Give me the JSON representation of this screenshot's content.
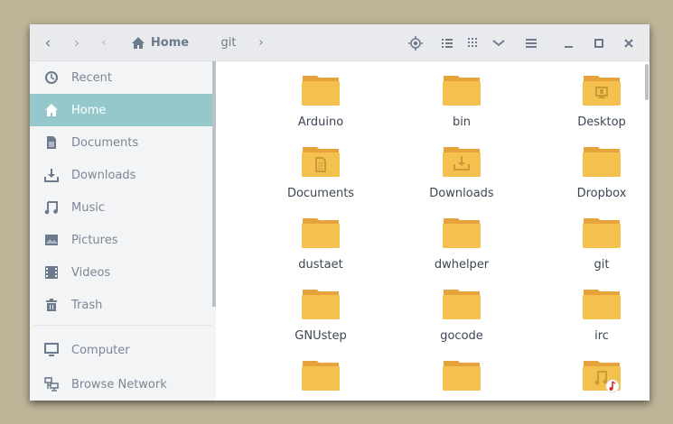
{
  "header": {
    "back": "back-icon",
    "forward": "forward-icon",
    "path_left": "path-left",
    "home_label": "Home",
    "crumb": "git",
    "path_right": "path-right"
  },
  "sidebar": {
    "items": [
      {
        "label": "Recent",
        "icon": "recent-icon"
      },
      {
        "label": "Home",
        "icon": "home-icon",
        "active": true
      },
      {
        "label": "Documents",
        "icon": "document-icon"
      },
      {
        "label": "Downloads",
        "icon": "download-icon"
      },
      {
        "label": "Music",
        "icon": "music-icon"
      },
      {
        "label": "Pictures",
        "icon": "picture-icon"
      },
      {
        "label": "Videos",
        "icon": "video-icon"
      },
      {
        "label": "Trash",
        "icon": "trash-icon"
      }
    ],
    "devices": [
      {
        "label": "Computer",
        "icon": "computer-icon"
      },
      {
        "label": "Browse Network",
        "icon": "network-icon"
      }
    ]
  },
  "files": [
    {
      "name": "Arduino",
      "emblem": ""
    },
    {
      "name": "bin",
      "emblem": ""
    },
    {
      "name": "Desktop",
      "emblem": "desktop"
    },
    {
      "name": "Documents",
      "emblem": "document"
    },
    {
      "name": "Downloads",
      "emblem": "download"
    },
    {
      "name": "Dropbox",
      "emblem": ""
    },
    {
      "name": "dustaet",
      "emblem": ""
    },
    {
      "name": "dwhelper",
      "emblem": ""
    },
    {
      "name": "git",
      "emblem": ""
    },
    {
      "name": "GNUstep",
      "emblem": ""
    },
    {
      "name": "gocode",
      "emblem": ""
    },
    {
      "name": "irc",
      "emblem": ""
    },
    {
      "name": "",
      "emblem": ""
    },
    {
      "name": "",
      "emblem": ""
    },
    {
      "name": "",
      "emblem": "music"
    }
  ],
  "colors": {
    "accent": "#94c8cb",
    "folder": "#f4c04e",
    "folder_tab": "#e6a33b"
  }
}
